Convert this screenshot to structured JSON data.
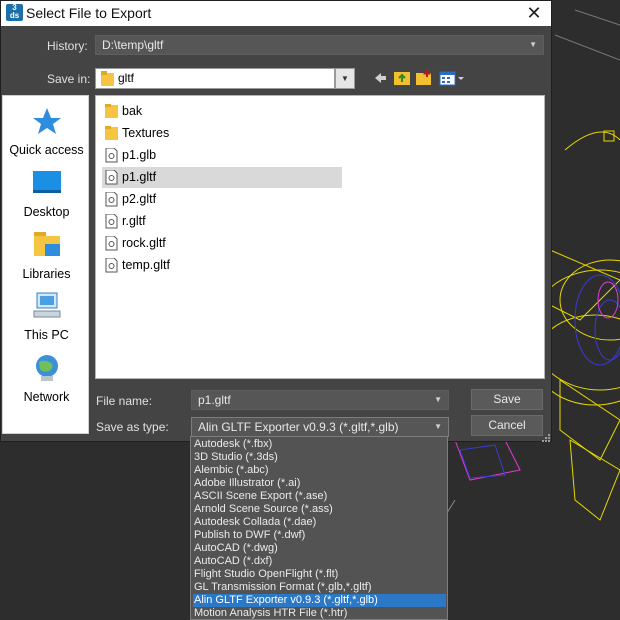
{
  "window": {
    "title": "Select File to Export",
    "close_glyph": "✕"
  },
  "history": {
    "label": "History:",
    "value": "D:\\temp\\gltf"
  },
  "save_in": {
    "label": "Save in:",
    "value": "gltf"
  },
  "places": [
    {
      "label": "Quick access",
      "icon": "star-icon"
    },
    {
      "label": "Desktop",
      "icon": "desktop-icon"
    },
    {
      "label": "Libraries",
      "icon": "libraries-icon"
    },
    {
      "label": "This PC",
      "icon": "computer-icon"
    },
    {
      "label": "Network",
      "icon": "network-icon"
    }
  ],
  "files": [
    {
      "name": "bak",
      "kind": "folder"
    },
    {
      "name": "Textures",
      "kind": "folder"
    },
    {
      "name": "p1.glb",
      "kind": "file"
    },
    {
      "name": "p1.gltf",
      "kind": "file",
      "selected": true
    },
    {
      "name": "p2.gltf",
      "kind": "file"
    },
    {
      "name": "r.gltf",
      "kind": "file"
    },
    {
      "name": "rock.gltf",
      "kind": "file"
    },
    {
      "name": "temp.gltf",
      "kind": "file"
    }
  ],
  "filename": {
    "label": "File name:",
    "value": "p1.gltf"
  },
  "filetype": {
    "label": "Save as type:",
    "value": "Alin GLTF Exporter v0.9.3 (*.gltf,*.glb)"
  },
  "buttons": {
    "save": "Save",
    "cancel": "Cancel"
  },
  "type_options": [
    "Autodesk (*.fbx)",
    "3D Studio (*.3ds)",
    "Alembic (*.abc)",
    "Adobe Illustrator (*.ai)",
    "ASCII Scene Export (*.ase)",
    "Arnold Scene Source (*.ass)",
    "Autodesk Collada (*.dae)",
    "Publish to DWF (*.dwf)",
    "AutoCAD (*.dwg)",
    "AutoCAD (*.dxf)",
    "Flight Studio OpenFlight (*.flt)",
    "GL Transmission Format (*.glb,*.gltf)",
    "Alin GLTF Exporter v0.9.3 (*.gltf,*.glb)",
    "Motion Analysis HTR File (*.htr)"
  ],
  "type_selected_index": 12,
  "colors": {
    "dialog_bg": "#444444",
    "selection_blue": "#2b78c7",
    "viewport_bg": "#2d2d2d"
  }
}
